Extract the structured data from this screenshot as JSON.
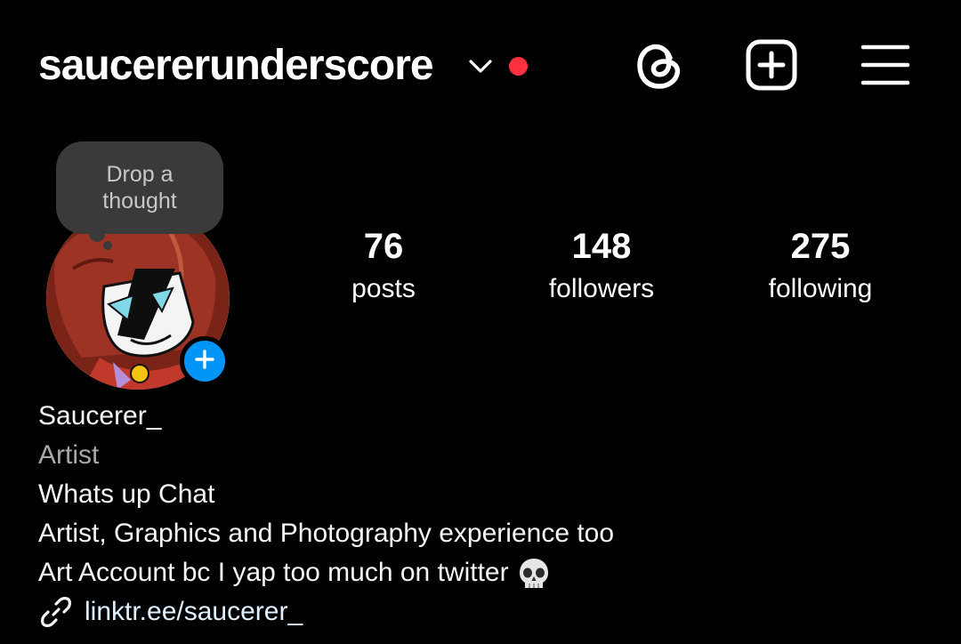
{
  "header": {
    "username": "saucererunderscore",
    "icons": {
      "dropdown": "chevron-down-icon",
      "notification_dot_color": "#ff3040",
      "threads": "threads-icon",
      "create": "add-square-icon",
      "menu": "hamburger-menu-icon"
    }
  },
  "note": {
    "text": "Drop a thought"
  },
  "avatar": {
    "add_story_icon": "plus-icon",
    "add_story_color": "#0095f6"
  },
  "stats": {
    "posts": {
      "value": "76",
      "label": "posts"
    },
    "followers": {
      "value": "148",
      "label": "followers"
    },
    "following": {
      "value": "275",
      "label": "following"
    }
  },
  "bio": {
    "display_name": "Saucerer_",
    "category": "Artist",
    "lines": [
      "Whats up Chat",
      "Artist, Graphics and Photography experience too",
      "Art Account bc I yap too much on twitter"
    ],
    "emoji": "skull-emoji",
    "link": "linktr.ee/saucerer_",
    "link_icon": "link-icon"
  }
}
